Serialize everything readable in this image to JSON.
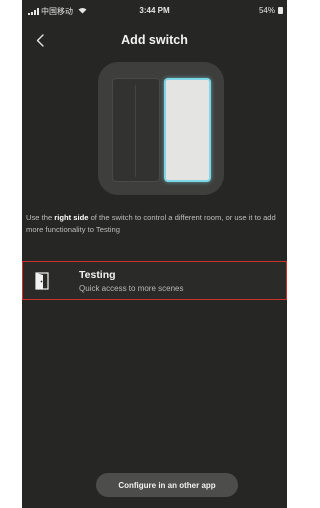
{
  "status_bar": {
    "carrier": "中国移动",
    "time": "3:44 PM",
    "battery": "54%"
  },
  "header": {
    "title": "Add switch",
    "back_icon": "chevron-left-icon"
  },
  "illustration": {
    "highlight_color": "#7fd6e6",
    "highlighted_side": "right"
  },
  "description": {
    "part1": "Use the ",
    "bold": "right side",
    "part2": " of the switch to control a different room, or use it to add more functionality to Testing"
  },
  "room": {
    "name": "Testing",
    "subtitle": "Quick access to more scenes",
    "icon": "door-icon",
    "selected_border_color": "#c9312b"
  },
  "footer": {
    "configure_label": "Configure in an other app"
  }
}
